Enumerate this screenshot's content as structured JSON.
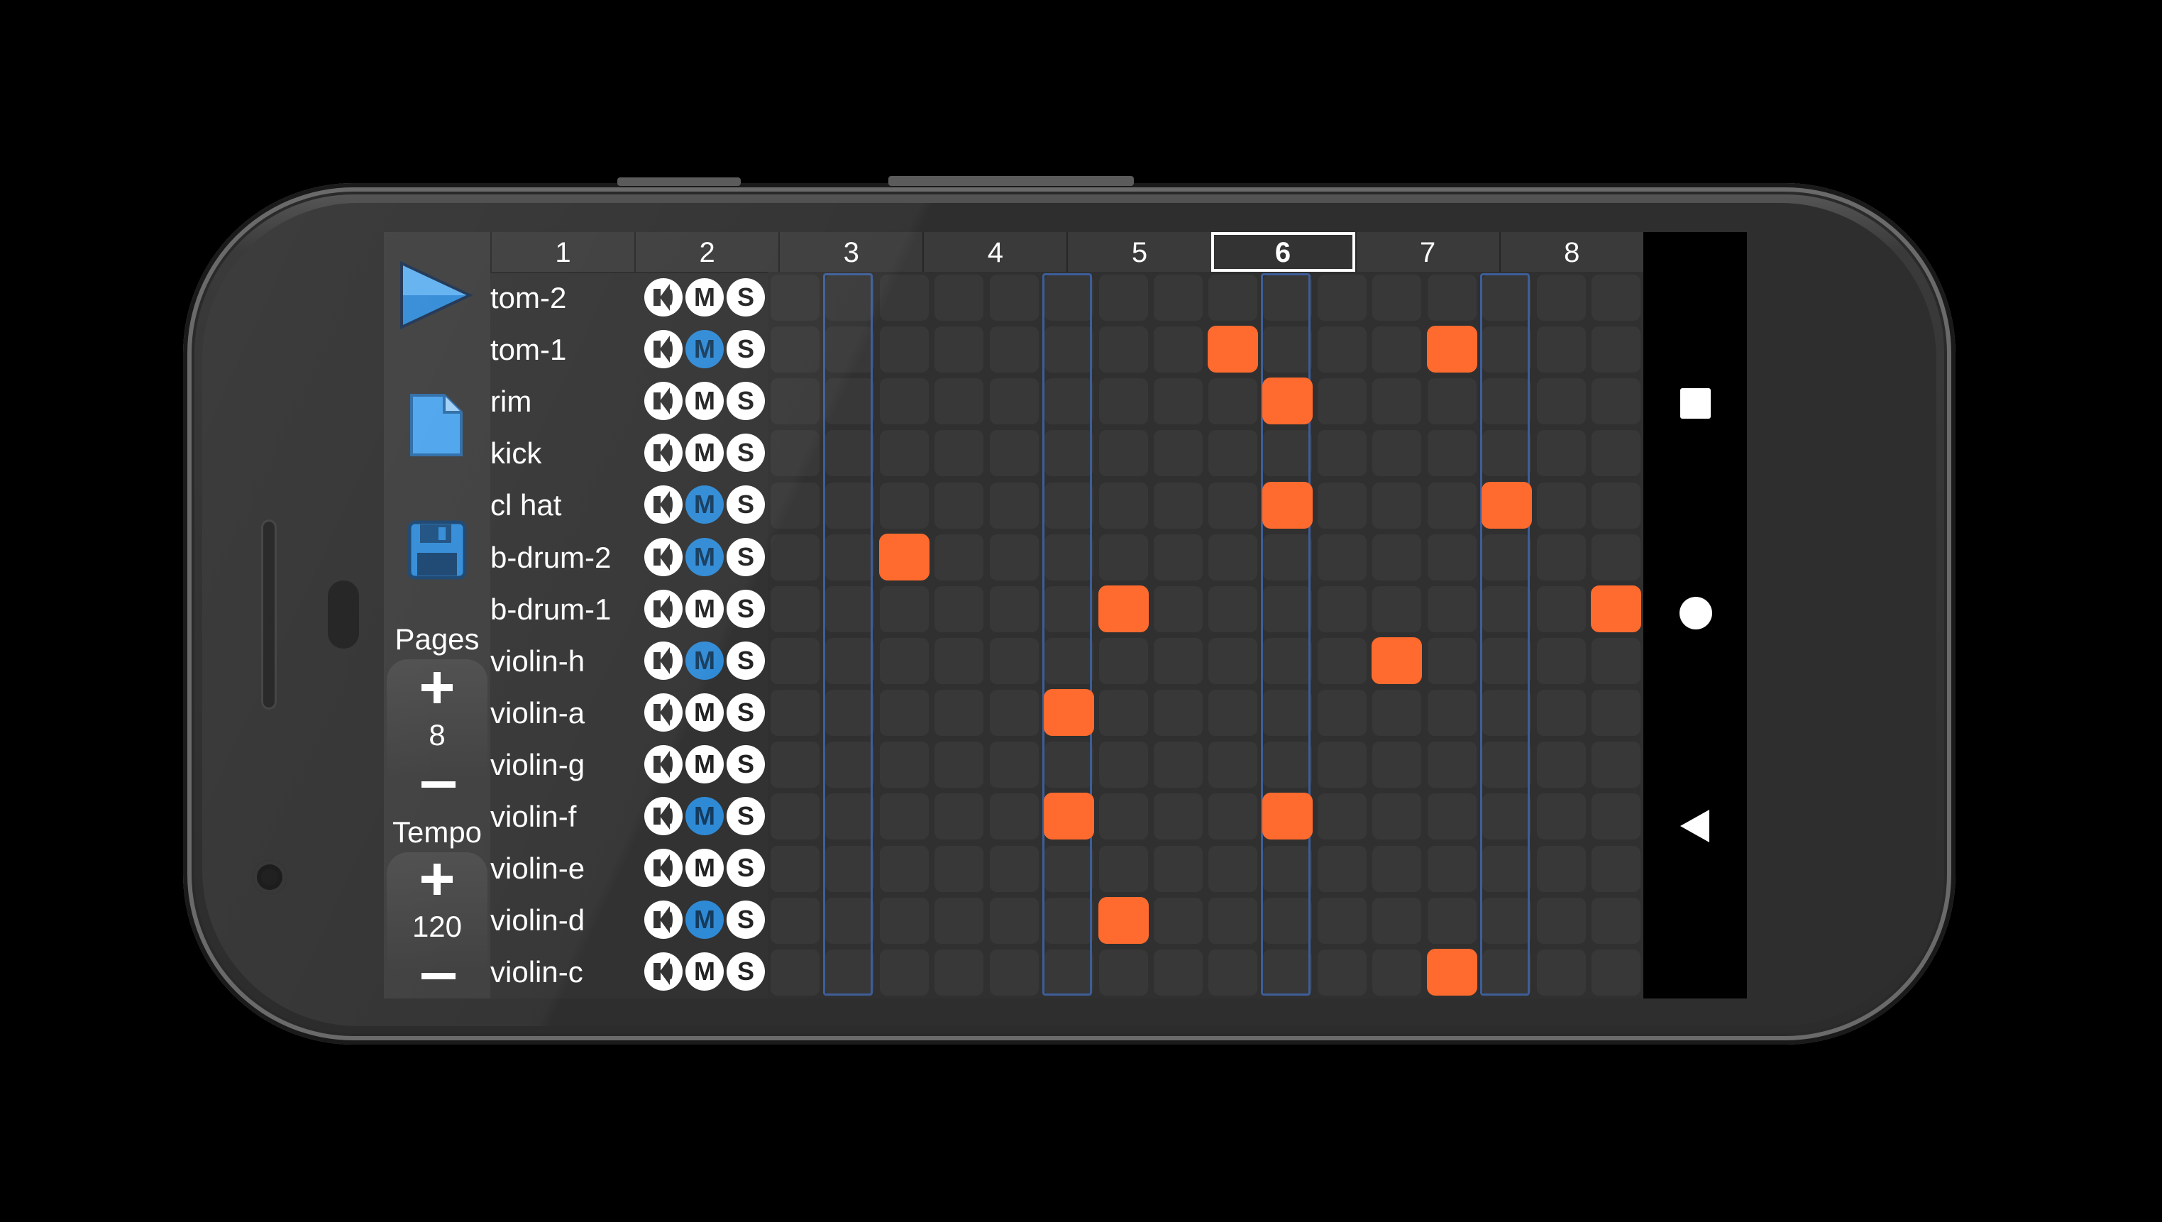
{
  "header": {
    "pages": [
      "1",
      "2",
      "3",
      "4",
      "5",
      "6",
      "7",
      "8"
    ],
    "active_page": "6"
  },
  "toolbar": {
    "play_icon": "play-icon",
    "new_icon": "new-file-icon",
    "save_icon": "save-icon",
    "pages_label": "Pages",
    "pages_value": "8",
    "tempo_label": "Tempo",
    "tempo_value": "120"
  },
  "tracks": [
    {
      "name": "tom-2",
      "mute": "M",
      "solo": "S",
      "muted": false
    },
    {
      "name": "tom-1",
      "mute": "M",
      "solo": "S",
      "muted": true
    },
    {
      "name": "rim",
      "mute": "M",
      "solo": "S",
      "muted": false
    },
    {
      "name": "kick",
      "mute": "M",
      "solo": "S",
      "muted": false
    },
    {
      "name": "cl hat",
      "mute": "M",
      "solo": "S",
      "muted": true
    },
    {
      "name": "b-drum-2",
      "mute": "M",
      "solo": "S",
      "muted": true
    },
    {
      "name": "b-drum-1",
      "mute": "M",
      "solo": "S",
      "muted": false
    },
    {
      "name": "violin-h",
      "mute": "M",
      "solo": "S",
      "muted": true
    },
    {
      "name": "violin-a",
      "mute": "M",
      "solo": "S",
      "muted": false
    },
    {
      "name": "violin-g",
      "mute": "M",
      "solo": "S",
      "muted": false
    },
    {
      "name": "violin-f",
      "mute": "M",
      "solo": "S",
      "muted": true
    },
    {
      "name": "violin-e",
      "mute": "M",
      "solo": "S",
      "muted": false
    },
    {
      "name": "violin-d",
      "mute": "M",
      "solo": "S",
      "muted": true
    },
    {
      "name": "violin-c",
      "mute": "M",
      "solo": "S",
      "muted": false
    }
  ],
  "sequencer": {
    "steps": 16,
    "highlighted_steps": [
      1,
      5,
      9,
      13
    ],
    "notes": [
      {
        "track": 1,
        "step": 8
      },
      {
        "track": 1,
        "step": 12
      },
      {
        "track": 2,
        "step": 9
      },
      {
        "track": 4,
        "step": 9
      },
      {
        "track": 4,
        "step": 13
      },
      {
        "track": 5,
        "step": 2
      },
      {
        "track": 6,
        "step": 6
      },
      {
        "track": 6,
        "step": 15
      },
      {
        "track": 7,
        "step": 11
      },
      {
        "track": 8,
        "step": 5
      },
      {
        "track": 10,
        "step": 5
      },
      {
        "track": 10,
        "step": 9
      },
      {
        "track": 12,
        "step": 6
      },
      {
        "track": 13,
        "step": 12
      }
    ]
  },
  "navigation": {
    "recents_icon": "square-icon",
    "home_icon": "circle-icon",
    "back_icon": "back-triangle-icon"
  },
  "colors": {
    "note": "#ff6b2e",
    "mute_active": "#2f8ad6",
    "step_highlight": "#3d5e99",
    "accent_blue": "#2f8ad6"
  }
}
